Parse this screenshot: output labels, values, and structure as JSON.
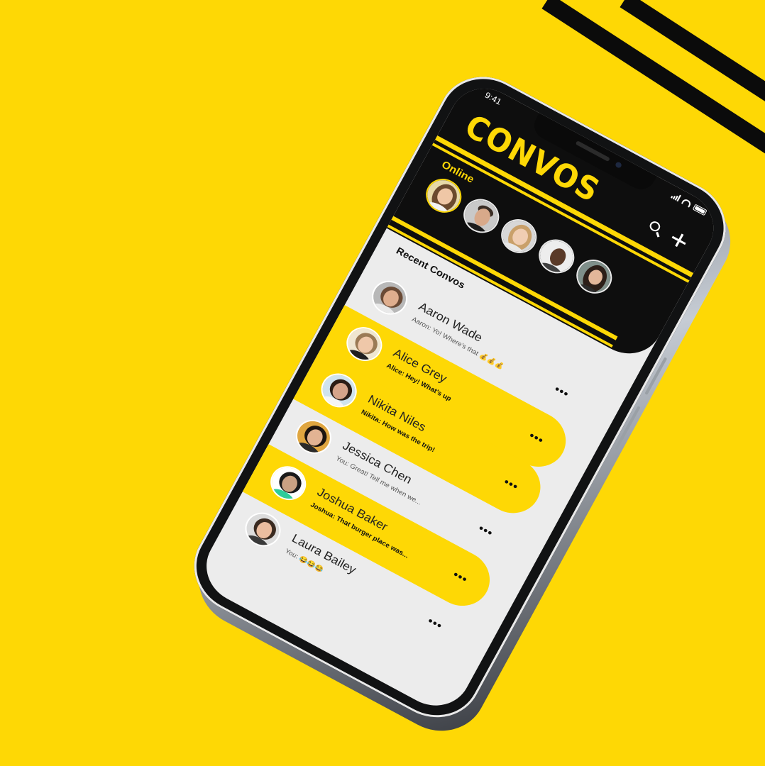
{
  "status": {
    "time": "9:41"
  },
  "app": {
    "logo": "CONVOS"
  },
  "header": {
    "search_icon": "search-icon",
    "new_icon": "plus-icon",
    "online_title": "Online",
    "online_users": [
      {
        "name": "online-user-1",
        "active": true
      },
      {
        "name": "online-user-2",
        "active": false
      },
      {
        "name": "online-user-3",
        "active": false
      },
      {
        "name": "online-user-4",
        "active": false
      },
      {
        "name": "online-user-5",
        "active": false
      }
    ]
  },
  "recent": {
    "title": "Recent Convos",
    "items": [
      {
        "name": "Aaron Wade",
        "message": "Aaron: Yo! Where's that 💰💰💰",
        "more": "•••",
        "highlight": false
      },
      {
        "name": "Alice Grey",
        "message": "Alice: Hey! What's up",
        "more": "•••",
        "highlight": true
      },
      {
        "name": "Nikita Niles",
        "message": "Nikita: How was the trip!",
        "more": "•••",
        "highlight": true
      },
      {
        "name": "Jessica Chen",
        "message": "You: Great! Tell me when we...",
        "more": "•••",
        "highlight": false
      },
      {
        "name": "Joshua Baker",
        "message": "Joshua: That burger place was...",
        "more": "•••",
        "highlight": true
      },
      {
        "name": "Laura Bailey",
        "message": "You: 😂😂😂",
        "more": "•••",
        "highlight": false
      }
    ]
  },
  "colors": {
    "accent": "#FED805",
    "dark": "#0E0E0E",
    "screen": "#ECECEC"
  }
}
